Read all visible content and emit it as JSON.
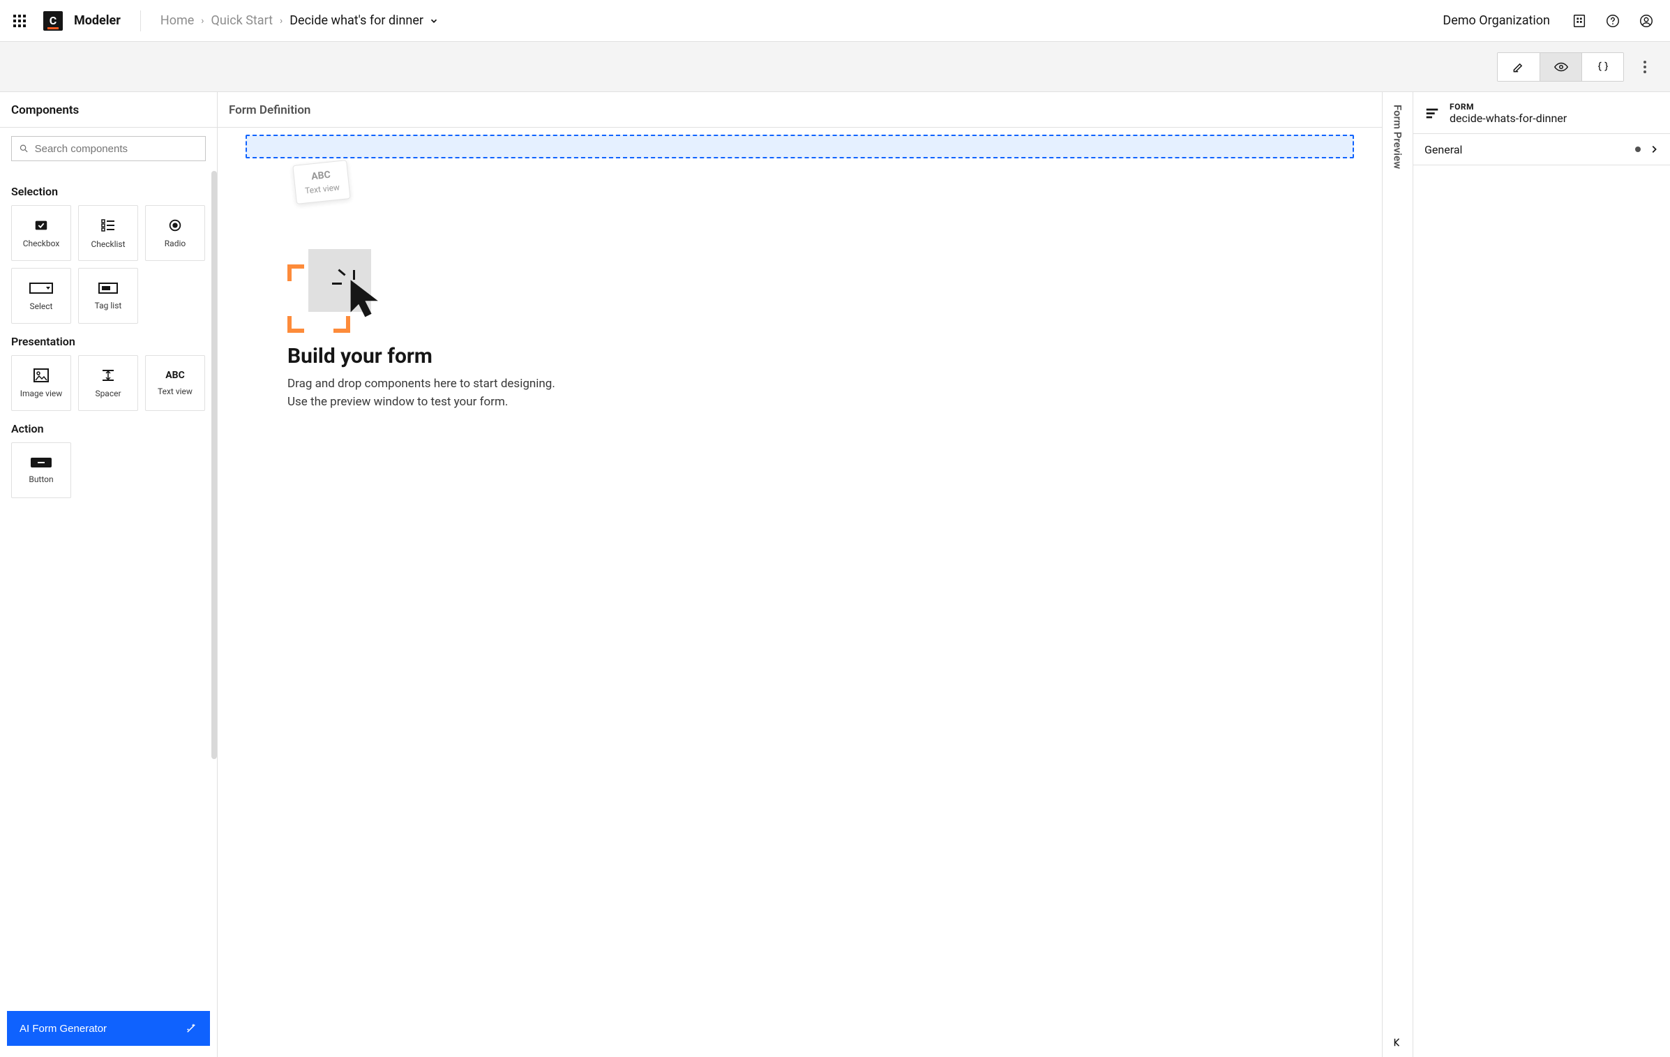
{
  "header": {
    "app_name": "Modeler",
    "breadcrumb": [
      "Home",
      "Quick Start"
    ],
    "current": "Decide what's for dinner",
    "org": "Demo Organization"
  },
  "modes": {
    "edit": "Edit",
    "preview": "Preview",
    "code": "Code"
  },
  "palette": {
    "title": "Components",
    "search_placeholder": "Search components",
    "ai_button": "AI Form Generator",
    "groups": [
      {
        "title": "Selection",
        "items": [
          {
            "id": "checkbox",
            "label": "Checkbox"
          },
          {
            "id": "checklist",
            "label": "Checklist"
          },
          {
            "id": "radio",
            "label": "Radio"
          },
          {
            "id": "select",
            "label": "Select"
          },
          {
            "id": "taglist",
            "label": "Tag list"
          }
        ]
      },
      {
        "title": "Presentation",
        "items": [
          {
            "id": "imageview",
            "label": "Image view"
          },
          {
            "id": "spacer",
            "label": "Spacer"
          },
          {
            "id": "textview",
            "label": "Text view"
          }
        ]
      },
      {
        "title": "Action",
        "items": [
          {
            "id": "button",
            "label": "Button"
          }
        ]
      }
    ]
  },
  "canvas": {
    "title": "Form Definition",
    "ghost_abc": "ABC",
    "ghost_label": "Text view",
    "empty_title": "Build your form",
    "empty_line1": "Drag and drop components here to start designing.",
    "empty_line2": "Use the preview window to test your form."
  },
  "preview_tab": {
    "label": "Form Preview"
  },
  "props": {
    "type_label": "FORM",
    "form_id": "decide-whats-for-dinner",
    "sections": [
      {
        "label": "General",
        "edited": true
      }
    ]
  }
}
